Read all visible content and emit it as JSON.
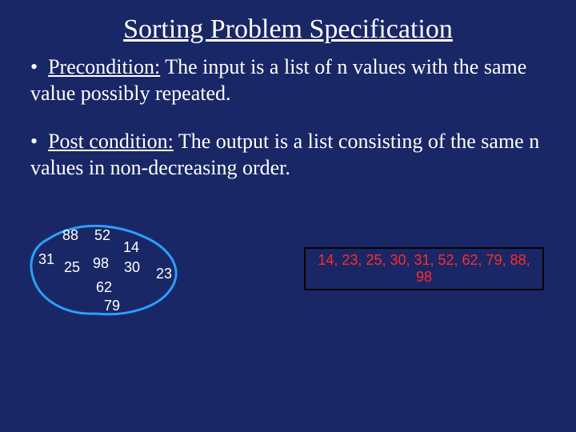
{
  "title": "Sorting Problem Specification",
  "precondition": {
    "label": "Precondition:",
    "text": "  The input is a list of n values with the same value possibly repeated."
  },
  "postcondition": {
    "label": "Post condition:",
    "text": " The output is a list consisting of the same n values in non-decreasing order."
  },
  "scatter": {
    "n0": "88",
    "n1": "52",
    "n2": "14",
    "n3": "31",
    "n4": "25",
    "n5": "98",
    "n6": "30",
    "n7": "23",
    "n8": "62",
    "n9": "79"
  },
  "sorted_list": "14, 23, 25, 30, 31, 52, 62, 79, 88, 98"
}
